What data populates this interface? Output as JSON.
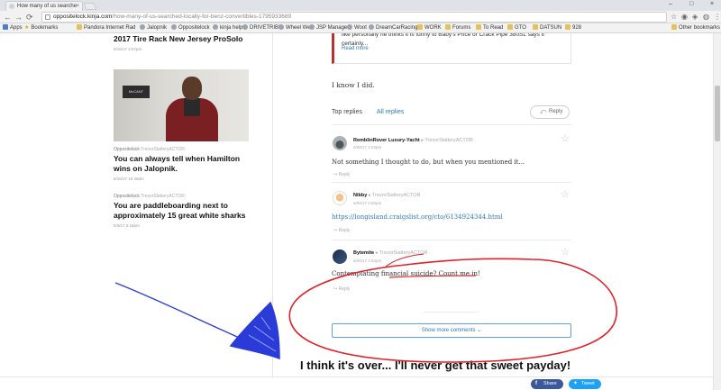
{
  "browser": {
    "tab_title": "How many of us searche",
    "tab_close": "×",
    "window_controls": [
      "–",
      "□",
      "×"
    ],
    "url_host": "oppositelock.kinja.com",
    "url_path": "/how-many-of-us-searched-locally-for-benz-convertibles-1795933689",
    "bookmarks": [
      "Apps",
      "Bookmarks",
      "Pandora Internet Rad",
      "Jalopnik",
      "Oppositelock",
      "kinja help",
      "DRIVETRIBE",
      "Wheel Well",
      "JSP Manager",
      "Woot",
      "DreamCarRacing",
      "WORK",
      "Forums",
      "To Read",
      "GTO",
      "DATSUN",
      "928",
      "Other bookmarks"
    ]
  },
  "left_column": {
    "headline1": "2017 Tire Rack New Jersey ProSolo",
    "meta1": "5/16/17 2:57pm",
    "image_sign": "McCANT",
    "kinja2": {
      "name": "Oppositelock",
      "sub": "TrevorSlatteryACTOR"
    },
    "headline2": "You can always tell when Hamilton wins on Jalopnik.",
    "meta2": "5/15/17 10:46am",
    "kinja3": {
      "name": "Oppositelock",
      "sub": "TrevorSlatteryACTOR"
    },
    "headline3": "You are paddleboarding next to approximately 15 great white sharks",
    "meta3": "5/3/17 2:16pm"
  },
  "main": {
    "embed_text": "like personally he thinks it is funny to Baby's Price or Crack Pipe 380SL says it certainly...",
    "read_more": "Read more",
    "comment_intro": "I know I did.",
    "tab_top": "Top replies",
    "tab_all": "All replies",
    "reply_button": "Reply",
    "replies": [
      {
        "name": "RemblinRover Luxury-Yacht",
        "to": "TrevorSlatteryACTOR",
        "date": "6/08/17 2:53pm",
        "text": "Not something I thought to do, but when you mentioned it...",
        "reply": "Reply"
      },
      {
        "name": "Nibby",
        "to": "TrevorSlatteryACTOR",
        "date": "6/08/17 2:50pm",
        "text": "https://longisland.craigslist.org/cto/6134924344.html",
        "reply": "Reply"
      },
      {
        "name": "Bytemite",
        "to": "TrevorSlatteryACTOR",
        "date": "6/08/17 2:53pm",
        "text": "Contemplating financial suicide? Count me in!",
        "reply": "Reply"
      }
    ],
    "show_more": "Show more comments"
  },
  "annotation": "I think it's over... I'll never get that sweet payday!",
  "share": {
    "facebook": "Share",
    "twitter": "Tweet"
  },
  "colors": {
    "accent": "#2f7ab9",
    "facebook": "#3b5998",
    "twitter": "#1da1f2",
    "annotation_red": "#e0202a",
    "annotation_blue": "#2a3bd8"
  }
}
